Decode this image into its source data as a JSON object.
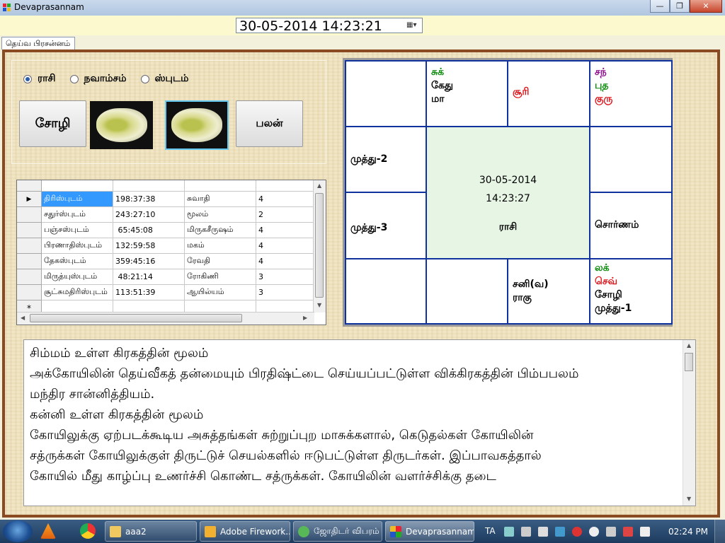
{
  "window": {
    "title": "Devaprasannam"
  },
  "datetime": {
    "value": "30-05-2014 14:23:21"
  },
  "tab": {
    "label": "தெய்வ பிரசன்னம்"
  },
  "radios": [
    {
      "label": "ராசி",
      "checked": true
    },
    {
      "label": "நவாம்சம்",
      "checked": false
    },
    {
      "label": "ஸ்புடம்",
      "checked": false
    }
  ],
  "buttons": {
    "sozhi": "சோழி",
    "palan": "பலன்"
  },
  "grid": {
    "rows": [
      [
        "திரிஸ்புடம்",
        "198:37:38",
        "சுவாதி",
        "4"
      ],
      [
        "சதுர்ஸ்புடம்",
        "243:27:10",
        "மூலம்",
        "2"
      ],
      [
        "பஞ்சஸ்புடம்",
        " 65:45:08",
        "மிருகசீருஷம்",
        "4"
      ],
      [
        "பிரணாதிஸ்புடம்",
        "132:59:58",
        "மகம்",
        "4"
      ],
      [
        "தேகஸ்புடம்",
        "359:45:16",
        "ரேவதி",
        "4"
      ],
      [
        "மிருத்யுஸ்புடம்",
        " 48:21:14",
        "ரோகிணி",
        "3"
      ],
      [
        "சூட்சுமதிரிஸ்புடம்",
        "113:51:39",
        "ஆயில்யம்",
        "3"
      ]
    ],
    "new_row_marker": "*",
    "current_row_marker": "▶"
  },
  "chart": {
    "center": {
      "date": "30-05-2014",
      "time": "14:23:27",
      "label": "ராசி"
    },
    "cells": {
      "r0c1": [
        {
          "text": "சுக்",
          "color": "green"
        },
        {
          "text": "கேது",
          "color": "black"
        },
        {
          "text": "மா",
          "color": "black"
        }
      ],
      "r0c2": [
        {
          "text": "சூரி",
          "color": "red"
        }
      ],
      "r0c3": [
        {
          "text": "சந்",
          "color": "purple"
        },
        {
          "text": "புத",
          "color": "green"
        },
        {
          "text": "குரு",
          "color": "red"
        }
      ],
      "r1c0": [
        {
          "text": "முத்து-2",
          "color": "black"
        }
      ],
      "r2c0": [
        {
          "text": "முத்து-3",
          "color": "black"
        }
      ],
      "r2c3": [
        {
          "text": "சொர்ணம்",
          "color": "black"
        }
      ],
      "r3c2": [
        {
          "text": "சனி(வ)",
          "color": "black"
        },
        {
          "text": "ராகு",
          "color": "black"
        }
      ],
      "r3c3": [
        {
          "text": "லக்",
          "color": "green"
        },
        {
          "text": "செவ்",
          "color": "red"
        },
        {
          "text": "சோழி",
          "color": "black"
        },
        {
          "text": "முத்து-1",
          "color": "black"
        }
      ]
    }
  },
  "result_text": [
    "சிம்மம் உள்ள கிரகத்தின் மூலம்",
    "அக்கோயிலின் தெய்வீகத் தன்மையும் பிரதிஷ்ட்டை செய்யப்பட்டுள்ள விக்கிரகத்தின் பிம்பபலம்",
    "மந்திர சான்னித்தியம்.",
    "கன்னி உள்ள கிரகத்தின் மூலம்",
    "கோயிலுக்கு ஏற்படக்கூடிய அசுத்தங்கள் சுற்றுப்புற மாசுக்களால், கெடுதல்கள் கோயிலின்",
    "சத்ருக்கள் கோயிலுக்குள் திருட்டுச் செயல்களில் ஈடுபட்டுள்ள திருடர்கள். இப்பாவகத்தால்",
    "கோயில் மீது காழ்ப்பு உணர்ச்சி கொண்ட சத்ருக்கள். கோயிலின் வளர்ச்சிக்கு தடை"
  ],
  "taskbar": {
    "tasks": [
      {
        "label": "aaa2",
        "icon": "folder-icon"
      },
      {
        "label": "Adobe Firework...",
        "icon": "fireworks-icon"
      },
      {
        "label": "ஜோதிடர் விபரம்",
        "icon": "app-icon"
      },
      {
        "label": "Devaprasannam",
        "icon": "app-icon"
      }
    ],
    "language": "TA",
    "clock": "02:24 PM"
  },
  "colors": {
    "chart_border": "#10329e",
    "center_bg": "#e6f5e4",
    "frame": "#8a4a22",
    "selection": "#3399ff"
  }
}
